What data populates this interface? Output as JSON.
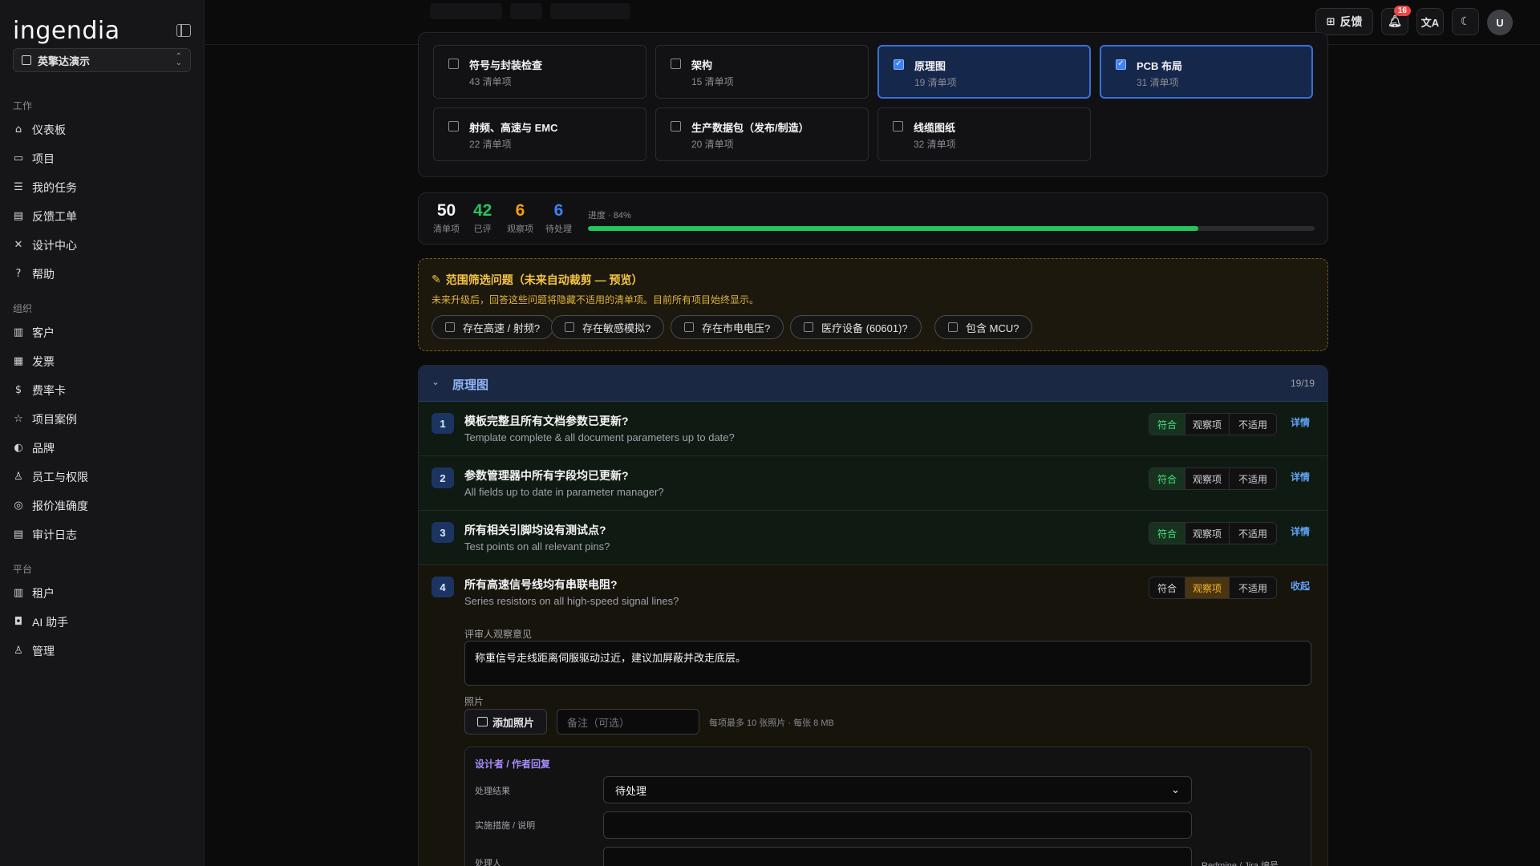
{
  "app": {
    "logo": "ingendia"
  },
  "workspace": {
    "label": "英擎达演示"
  },
  "sidebar": {
    "sections": [
      {
        "title": "工作",
        "items": [
          {
            "label": "仪表板",
            "icon": "home-icon"
          },
          {
            "label": "项目",
            "icon": "folder-icon"
          },
          {
            "label": "我的任务",
            "icon": "list-check-icon"
          },
          {
            "label": "反馈工单",
            "icon": "ticket-icon"
          },
          {
            "label": "设计中心",
            "icon": "tools-icon"
          },
          {
            "label": "帮助",
            "icon": "help-icon"
          }
        ]
      },
      {
        "title": "组织",
        "items": [
          {
            "label": "客户",
            "icon": "building-icon"
          },
          {
            "label": "发票",
            "icon": "invoice-icon"
          },
          {
            "label": "费率卡",
            "icon": "dollar-icon"
          },
          {
            "label": "项目案例",
            "icon": "star-icon"
          },
          {
            "label": "品牌",
            "icon": "palette-icon"
          },
          {
            "label": "员工与权限",
            "icon": "user-key-icon"
          },
          {
            "label": "报价准确度",
            "icon": "target-icon"
          },
          {
            "label": "审计日志",
            "icon": "log-icon"
          }
        ]
      },
      {
        "title": "平台",
        "items": [
          {
            "label": "租户",
            "icon": "tenant-icon"
          },
          {
            "label": "AI 助手",
            "icon": "bot-icon"
          },
          {
            "label": "管理",
            "icon": "users-icon"
          }
        ]
      }
    ]
  },
  "topbar": {
    "feedback_label": "反馈",
    "notification_count": "16",
    "avatar_initial": "U"
  },
  "categories": [
    {
      "title": "符号与封装检查",
      "count": "43 清单项",
      "selected": false
    },
    {
      "title": "架构",
      "count": "15 清单项",
      "selected": false
    },
    {
      "title": "原理图",
      "count": "19 清单项",
      "selected": true
    },
    {
      "title": "PCB 布局",
      "count": "31 清单项",
      "selected": true
    },
    {
      "title": "射频、高速与 EMC",
      "count": "22 清单项",
      "selected": false
    },
    {
      "title": "生产数据包（发布/制造）",
      "count": "20 清单项",
      "selected": false
    },
    {
      "title": "线缆图纸",
      "count": "32 清单项",
      "selected": false
    }
  ],
  "stats": {
    "items": [
      {
        "value": "50",
        "label": "清单项",
        "color": "#f4f4f5"
      },
      {
        "value": "42",
        "label": "已评",
        "color": "#22c55e"
      },
      {
        "value": "6",
        "label": "观察项",
        "color": "#f59e0b"
      },
      {
        "value": "6",
        "label": "待处理",
        "color": "#3b82f6"
      }
    ],
    "progress_label": "进度 · 84%",
    "progress_fraction": 0.84
  },
  "scope": {
    "title": "范围筛选问题（未来自动裁剪 — 预览）",
    "description": "未来升级后，回答这些问题将隐藏不适用的清单项。目前所有项目始终显示。",
    "chips": [
      "存在高速 / 射频?",
      "存在敏感模拟?",
      "存在市电电压?",
      "医疗设备 (60601)?",
      "包含 MCU?"
    ]
  },
  "section": {
    "title": "原理图",
    "count": "19/19",
    "options": [
      "符合",
      "观察项",
      "不适用"
    ],
    "items": [
      {
        "num": "1",
        "title": "模板完整且所有文档参数已更新?",
        "subtitle": "Template complete & all document parameters up to date?",
        "state": "ok",
        "action": "详情"
      },
      {
        "num": "2",
        "title": "参数管理器中所有字段均已更新?",
        "subtitle": "All fields up to date in parameter manager?",
        "state": "ok",
        "action": "详情"
      },
      {
        "num": "3",
        "title": "所有相关引脚均设有测试点?",
        "subtitle": "Test points on all relevant pins?",
        "state": "ok",
        "action": "详情"
      },
      {
        "num": "4",
        "title": "所有高速信号线均有串联电阻?",
        "subtitle": "Series resistors on all high-speed signal lines?",
        "state": "warn",
        "action": "收起"
      }
    ],
    "expanded": {
      "observation_label": "评审人观察意见",
      "observation_text": "称重信号走线距离伺服驱动过近，建议加屏蔽并改走底层。",
      "photos_label": "照片",
      "add_photo_label": "添加照片",
      "note_placeholder": "备注（可选）",
      "photo_hint": "每项最多 10 张照片 · 每张 8 MB",
      "reply_title": "设计者 / 作者回复",
      "result_label": "处理结果",
      "result_value": "待处理",
      "measures_label": "实施措施 / 说明",
      "handler_label": "处理人",
      "ticket_label": "Redmine / Jira 编号"
    }
  }
}
